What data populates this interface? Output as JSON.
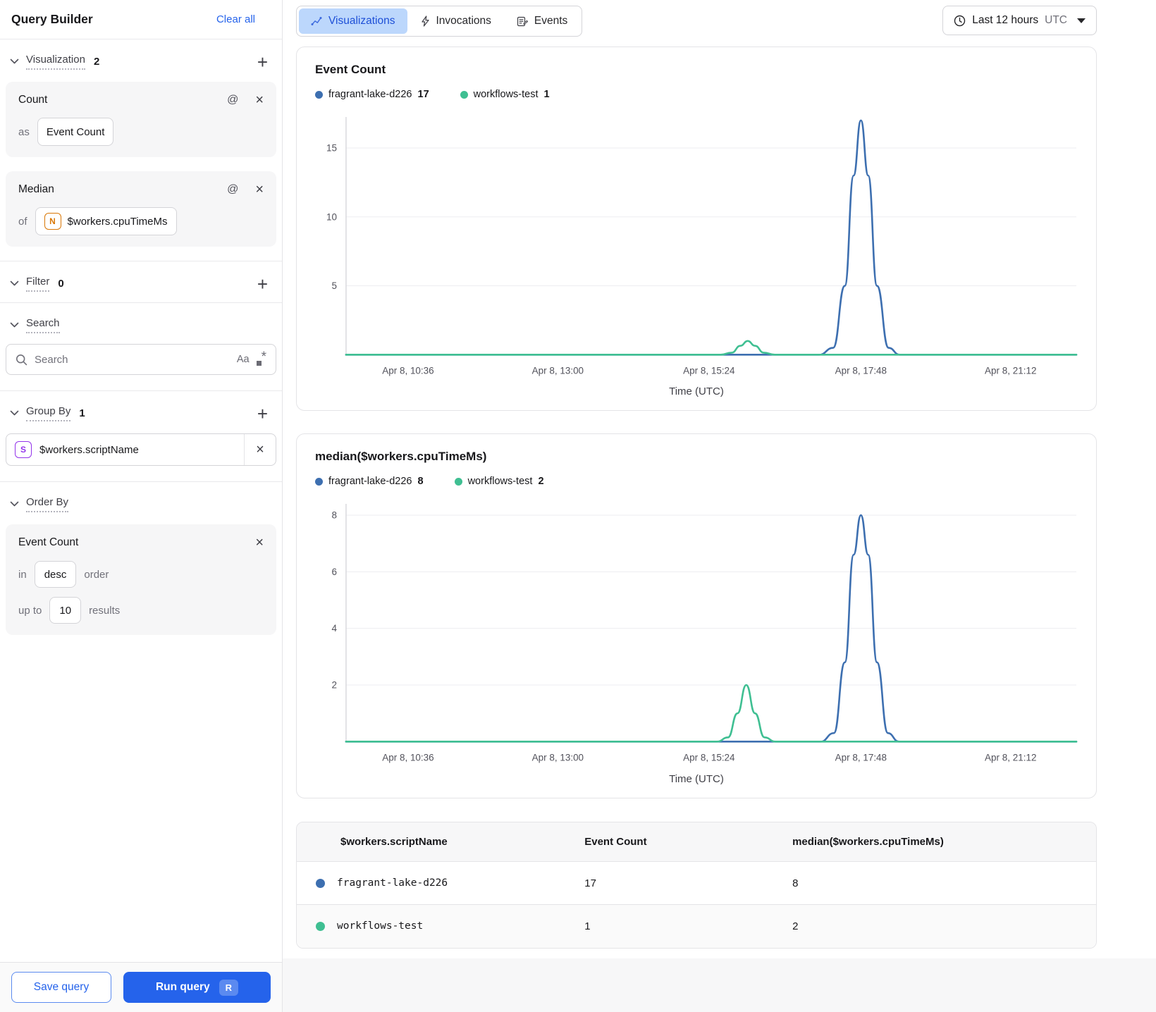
{
  "icons": {
    "at": "@",
    "close": "×",
    "plus": "+",
    "case": "Aa",
    "regex_star": "*"
  },
  "colors": {
    "accent_blue": "#2563eb",
    "active_tab_bg": "#bcd7fc",
    "series_blue": "#3d6fb0",
    "series_green": "#3fbf92",
    "badge_orange": "#d97706",
    "badge_purple": "#9333ea"
  },
  "sidebar": {
    "title": "Query Builder",
    "clear_all": "Clear all",
    "visualization": {
      "label": "Visualization",
      "count": "2",
      "cards": [
        {
          "title": "Count",
          "as_label": "as",
          "value": "Event Count"
        },
        {
          "title": "Median",
          "of_label": "of",
          "field_badge": "N",
          "value": "$workers.cpuTimeMs"
        }
      ]
    },
    "filter": {
      "label": "Filter",
      "count": "0"
    },
    "search": {
      "label": "Search",
      "placeholder": "Search"
    },
    "group_by": {
      "label": "Group By",
      "count": "1",
      "field_badge": "S",
      "value": "$workers.scriptName"
    },
    "order_by": {
      "label": "Order By",
      "field": "Event Count",
      "in_label": "in",
      "direction": "desc",
      "order_label": "order",
      "up_to_label": "up to",
      "limit": "10",
      "results_label": "results"
    },
    "footer": {
      "save": "Save query",
      "run": "Run query",
      "run_shortcut": "R"
    }
  },
  "toolbar": {
    "tabs": [
      {
        "label": "Visualizations",
        "active": true
      },
      {
        "label": "Invocations",
        "active": false
      },
      {
        "label": "Events",
        "active": false
      }
    ],
    "time_range": {
      "label": "Last 12 hours",
      "timezone": "UTC"
    }
  },
  "chart_data": [
    {
      "type": "line",
      "title": "Event Count",
      "xlabel": "Time (UTC)",
      "grid": true,
      "legend_position": "top",
      "ylim": [
        0,
        17.25
      ],
      "y_ticks": [
        5,
        10,
        15
      ],
      "x_ticks": [
        "Apr 8, 10:36",
        "Apr 8, 13:00",
        "Apr 8, 15:24",
        "Apr 8, 17:48",
        "Apr 8, 21:12"
      ],
      "x_tick_pos": [
        0.085,
        0.29,
        0.497,
        0.705,
        0.91
      ],
      "legend": [
        {
          "name": "fragrant-lake-d226",
          "value": 17,
          "color": "#3d6fb0"
        },
        {
          "name": "workflows-test",
          "value": 1,
          "color": "#3fbf92"
        }
      ],
      "series": [
        {
          "name": "fragrant-lake-d226",
          "color": "#3d6fb0",
          "points": [
            [
              0,
              0
            ],
            [
              0.648,
              0
            ],
            [
              0.667,
              0.5
            ],
            [
              0.683,
              5
            ],
            [
              0.695,
              13
            ],
            [
              0.705,
              17
            ],
            [
              0.715,
              13
            ],
            [
              0.727,
              5
            ],
            [
              0.743,
              0.5
            ],
            [
              0.758,
              0
            ],
            [
              1,
              0
            ]
          ]
        },
        {
          "name": "workflows-test",
          "color": "#3fbf92",
          "points": [
            [
              0,
              0
            ],
            [
              0.513,
              0
            ],
            [
              0.528,
              0.15
            ],
            [
              0.54,
              0.65
            ],
            [
              0.55,
              1
            ],
            [
              0.56,
              0.65
            ],
            [
              0.572,
              0.15
            ],
            [
              0.587,
              0
            ],
            [
              1,
              0
            ]
          ]
        }
      ]
    },
    {
      "type": "line",
      "title": "median($workers.cpuTimeMs)",
      "xlabel": "Time (UTC)",
      "grid": true,
      "legend_position": "top",
      "ylim": [
        0,
        8.4
      ],
      "y_ticks": [
        2,
        4,
        6,
        8
      ],
      "x_ticks": [
        "Apr 8, 10:36",
        "Apr 8, 13:00",
        "Apr 8, 15:24",
        "Apr 8, 17:48",
        "Apr 8, 21:12"
      ],
      "x_tick_pos": [
        0.085,
        0.29,
        0.497,
        0.705,
        0.91
      ],
      "legend": [
        {
          "name": "fragrant-lake-d226",
          "value": 8,
          "color": "#3d6fb0"
        },
        {
          "name": "workflows-test",
          "value": 2,
          "color": "#3fbf92"
        }
      ],
      "series": [
        {
          "name": "fragrant-lake-d226",
          "color": "#3d6fb0",
          "points": [
            [
              0,
              0
            ],
            [
              0.65,
              0
            ],
            [
              0.668,
              0.3
            ],
            [
              0.683,
              2.8
            ],
            [
              0.695,
              6.6
            ],
            [
              0.705,
              8
            ],
            [
              0.715,
              6.6
            ],
            [
              0.727,
              2.8
            ],
            [
              0.742,
              0.3
            ],
            [
              0.757,
              0
            ],
            [
              1,
              0
            ]
          ]
        },
        {
          "name": "workflows-test",
          "color": "#3fbf92",
          "points": [
            [
              0,
              0
            ],
            [
              0.508,
              0
            ],
            [
              0.523,
              0.15
            ],
            [
              0.536,
              1
            ],
            [
              0.548,
              2
            ],
            [
              0.56,
              1
            ],
            [
              0.573,
              0.15
            ],
            [
              0.588,
              0
            ],
            [
              1,
              0
            ]
          ]
        }
      ]
    }
  ],
  "table": {
    "columns": [
      "$workers.scriptName",
      "Event Count",
      "median($workers.cpuTimeMs)"
    ],
    "rows": [
      {
        "script_name": "fragrant-lake-d226",
        "dot_color": "#3d6fb0",
        "event_count": "17",
        "median": "8"
      },
      {
        "script_name": "workflows-test",
        "dot_color": "#3fbf92",
        "event_count": "1",
        "median": "2"
      }
    ]
  }
}
